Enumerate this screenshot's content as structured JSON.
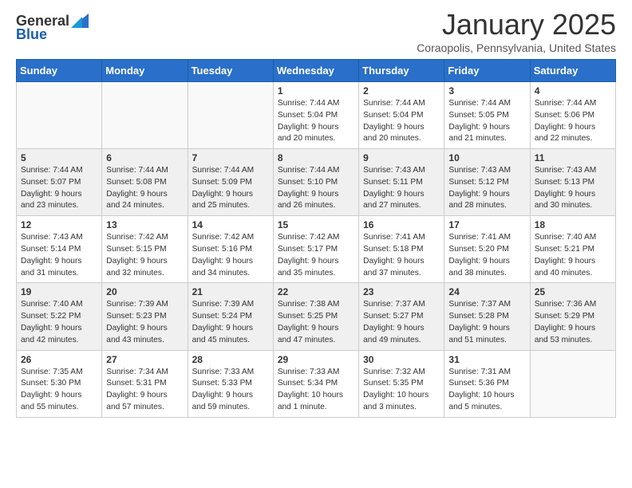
{
  "header": {
    "logo_general": "General",
    "logo_blue": "Blue",
    "month_title": "January 2025",
    "subtitle": "Coraopolis, Pennsylvania, United States"
  },
  "calendar": {
    "days_of_week": [
      "Sunday",
      "Monday",
      "Tuesday",
      "Wednesday",
      "Thursday",
      "Friday",
      "Saturday"
    ],
    "weeks": [
      [
        {
          "day": "",
          "info": ""
        },
        {
          "day": "",
          "info": ""
        },
        {
          "day": "",
          "info": ""
        },
        {
          "day": "1",
          "info": "Sunrise: 7:44 AM\nSunset: 5:04 PM\nDaylight: 9 hours\nand 20 minutes."
        },
        {
          "day": "2",
          "info": "Sunrise: 7:44 AM\nSunset: 5:04 PM\nDaylight: 9 hours\nand 20 minutes."
        },
        {
          "day": "3",
          "info": "Sunrise: 7:44 AM\nSunset: 5:05 PM\nDaylight: 9 hours\nand 21 minutes."
        },
        {
          "day": "4",
          "info": "Sunrise: 7:44 AM\nSunset: 5:06 PM\nDaylight: 9 hours\nand 22 minutes."
        }
      ],
      [
        {
          "day": "5",
          "info": "Sunrise: 7:44 AM\nSunset: 5:07 PM\nDaylight: 9 hours\nand 23 minutes."
        },
        {
          "day": "6",
          "info": "Sunrise: 7:44 AM\nSunset: 5:08 PM\nDaylight: 9 hours\nand 24 minutes."
        },
        {
          "day": "7",
          "info": "Sunrise: 7:44 AM\nSunset: 5:09 PM\nDaylight: 9 hours\nand 25 minutes."
        },
        {
          "day": "8",
          "info": "Sunrise: 7:44 AM\nSunset: 5:10 PM\nDaylight: 9 hours\nand 26 minutes."
        },
        {
          "day": "9",
          "info": "Sunrise: 7:43 AM\nSunset: 5:11 PM\nDaylight: 9 hours\nand 27 minutes."
        },
        {
          "day": "10",
          "info": "Sunrise: 7:43 AM\nSunset: 5:12 PM\nDaylight: 9 hours\nand 28 minutes."
        },
        {
          "day": "11",
          "info": "Sunrise: 7:43 AM\nSunset: 5:13 PM\nDaylight: 9 hours\nand 30 minutes."
        }
      ],
      [
        {
          "day": "12",
          "info": "Sunrise: 7:43 AM\nSunset: 5:14 PM\nDaylight: 9 hours\nand 31 minutes."
        },
        {
          "day": "13",
          "info": "Sunrise: 7:42 AM\nSunset: 5:15 PM\nDaylight: 9 hours\nand 32 minutes."
        },
        {
          "day": "14",
          "info": "Sunrise: 7:42 AM\nSunset: 5:16 PM\nDaylight: 9 hours\nand 34 minutes."
        },
        {
          "day": "15",
          "info": "Sunrise: 7:42 AM\nSunset: 5:17 PM\nDaylight: 9 hours\nand 35 minutes."
        },
        {
          "day": "16",
          "info": "Sunrise: 7:41 AM\nSunset: 5:18 PM\nDaylight: 9 hours\nand 37 minutes."
        },
        {
          "day": "17",
          "info": "Sunrise: 7:41 AM\nSunset: 5:20 PM\nDaylight: 9 hours\nand 38 minutes."
        },
        {
          "day": "18",
          "info": "Sunrise: 7:40 AM\nSunset: 5:21 PM\nDaylight: 9 hours\nand 40 minutes."
        }
      ],
      [
        {
          "day": "19",
          "info": "Sunrise: 7:40 AM\nSunset: 5:22 PM\nDaylight: 9 hours\nand 42 minutes."
        },
        {
          "day": "20",
          "info": "Sunrise: 7:39 AM\nSunset: 5:23 PM\nDaylight: 9 hours\nand 43 minutes."
        },
        {
          "day": "21",
          "info": "Sunrise: 7:39 AM\nSunset: 5:24 PM\nDaylight: 9 hours\nand 45 minutes."
        },
        {
          "day": "22",
          "info": "Sunrise: 7:38 AM\nSunset: 5:25 PM\nDaylight: 9 hours\nand 47 minutes."
        },
        {
          "day": "23",
          "info": "Sunrise: 7:37 AM\nSunset: 5:27 PM\nDaylight: 9 hours\nand 49 minutes."
        },
        {
          "day": "24",
          "info": "Sunrise: 7:37 AM\nSunset: 5:28 PM\nDaylight: 9 hours\nand 51 minutes."
        },
        {
          "day": "25",
          "info": "Sunrise: 7:36 AM\nSunset: 5:29 PM\nDaylight: 9 hours\nand 53 minutes."
        }
      ],
      [
        {
          "day": "26",
          "info": "Sunrise: 7:35 AM\nSunset: 5:30 PM\nDaylight: 9 hours\nand 55 minutes."
        },
        {
          "day": "27",
          "info": "Sunrise: 7:34 AM\nSunset: 5:31 PM\nDaylight: 9 hours\nand 57 minutes."
        },
        {
          "day": "28",
          "info": "Sunrise: 7:33 AM\nSunset: 5:33 PM\nDaylight: 9 hours\nand 59 minutes."
        },
        {
          "day": "29",
          "info": "Sunrise: 7:33 AM\nSunset: 5:34 PM\nDaylight: 10 hours\nand 1 minute."
        },
        {
          "day": "30",
          "info": "Sunrise: 7:32 AM\nSunset: 5:35 PM\nDaylight: 10 hours\nand 3 minutes."
        },
        {
          "day": "31",
          "info": "Sunrise: 7:31 AM\nSunset: 5:36 PM\nDaylight: 10 hours\nand 5 minutes."
        },
        {
          "day": "",
          "info": ""
        }
      ]
    ]
  }
}
